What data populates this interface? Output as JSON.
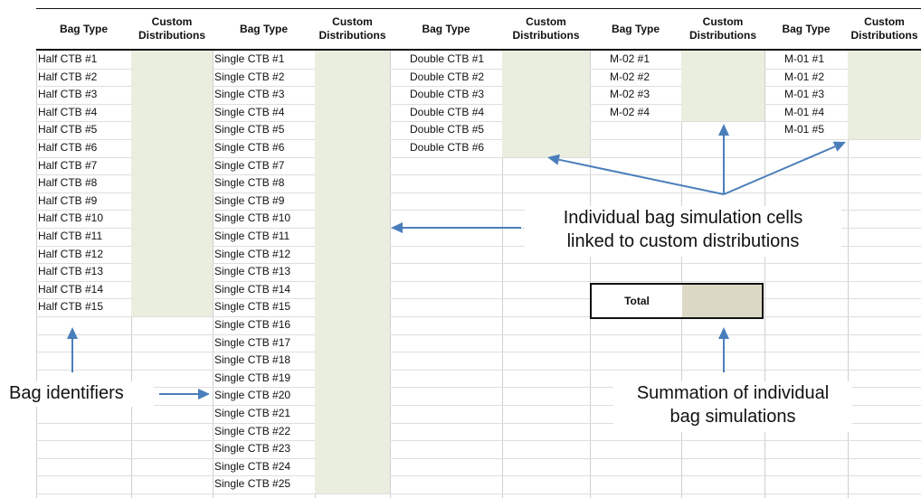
{
  "headers": [
    "Bag Type",
    "Custom\nDistributions",
    "Bag Type",
    "Custom\nDistributions",
    "Bag Type",
    "Custom\nDistributions",
    "Bag Type",
    "Custom\nDistributions",
    "Bag Type",
    "Custom\nDistributions"
  ],
  "half_ctb": [
    "Half CTB #1",
    "Half CTB #2",
    "Half CTB #3",
    "Half CTB #4",
    "Half CTB #5",
    "Half CTB #6",
    "Half CTB #7",
    "Half CTB #8",
    "Half CTB #9",
    "Half CTB #10",
    "Half CTB #11",
    "Half CTB #12",
    "Half CTB #13",
    "Half CTB #14",
    "Half CTB #15"
  ],
  "single_ctb": [
    "Single CTB #1",
    "Single CTB #2",
    "Single CTB #3",
    "Single CTB #4",
    "Single CTB #5",
    "Single CTB #6",
    "Single CTB #7",
    "Single CTB #8",
    "Single CTB #9",
    "Single CTB #10",
    "Single CTB #11",
    "Single CTB #12",
    "Single CTB #13",
    "Single CTB #14",
    "Single CTB #15",
    "Single CTB #16",
    "Single CTB #17",
    "Single CTB #18",
    "Single CTB #19",
    "Single CTB #20",
    "Single CTB #21",
    "Single CTB #22",
    "Single CTB #23",
    "Single CTB #24",
    "Single CTB #25"
  ],
  "double_ctb": [
    "Double CTB #1",
    "Double CTB #2",
    "Double CTB #3",
    "Double CTB #4",
    "Double CTB #5",
    "Double CTB #6"
  ],
  "m02": [
    "M-02 #1",
    "M-02 #2",
    "M-02 #3",
    "M-02 #4"
  ],
  "m01": [
    "M-01 #1",
    "M-01 #2",
    "M-01 #3",
    "M-01 #4",
    "M-01 #5"
  ],
  "total_label": "Total",
  "callouts": {
    "individual_line1": "Individual bag simulation cells",
    "individual_line2": "linked to custom distributions",
    "bag_identifiers": "Bag identifiers",
    "summation_line1": "Summation of individual",
    "summation_line2": "bag simulations"
  },
  "colors": {
    "distribution_fill": "#eaeedf",
    "total_fill": "#dcd8c6",
    "arrow": "#4a7ebb"
  }
}
